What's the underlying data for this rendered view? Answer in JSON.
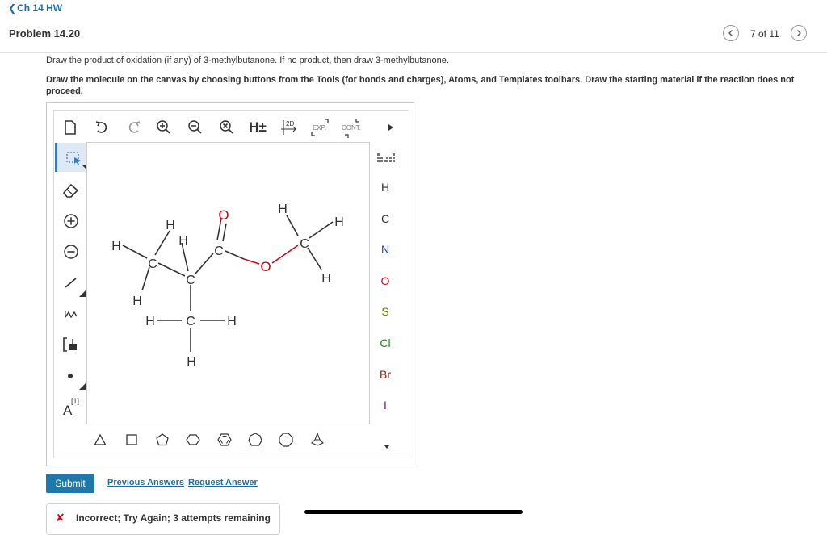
{
  "header": {
    "back_label": "Ch 14 HW",
    "problem_title": "Problem 14.20",
    "page_counter": "7 of 11"
  },
  "instructions": {
    "line1": "Draw the product of oxidation (if any) of 3-methylbutanone. If no product, then draw 3-methylbutanone.",
    "line2": "Draw the molecule on the canvas by choosing buttons from the Tools (for bonds and charges), Atoms, and Templates toolbars. Draw the starting material if the reaction does not proceed."
  },
  "top_toolbar": {
    "h_plus_label": "H±",
    "twod_label": "2D",
    "exp_label": "EXP.",
    "cont_label": "CONT."
  },
  "left_toolbar": {
    "atom_map_label": "A",
    "atom_map_superscript": "[1]"
  },
  "atoms_toolbar": {
    "atoms": [
      {
        "symbol": "H",
        "color": "#333333"
      },
      {
        "symbol": "C",
        "color": "#333333"
      },
      {
        "symbol": "N",
        "color": "#1f3fb5"
      },
      {
        "symbol": "O",
        "color": "#d0021b"
      },
      {
        "symbol": "S",
        "color": "#6b7a00"
      },
      {
        "symbol": "Cl",
        "color": "#1a8a1a"
      },
      {
        "symbol": "Br",
        "color": "#7a2a10"
      },
      {
        "symbol": "I",
        "color": "#6a1a8a"
      }
    ]
  },
  "molecule": {
    "atoms": {
      "C": "C",
      "O": "O",
      "H": "H"
    }
  },
  "actions": {
    "submit_label": "Submit",
    "previous_answers": "Previous Answers",
    "request_answer": "Request Answer"
  },
  "feedback": {
    "icon": "x-icon",
    "message": "Incorrect; Try Again; 3 attempts remaining"
  },
  "colors": {
    "link": "#1f6f9e",
    "submit_bg": "#2178a6",
    "oxygen": "#d0021b",
    "select_highlight": "#dfe9f5"
  }
}
